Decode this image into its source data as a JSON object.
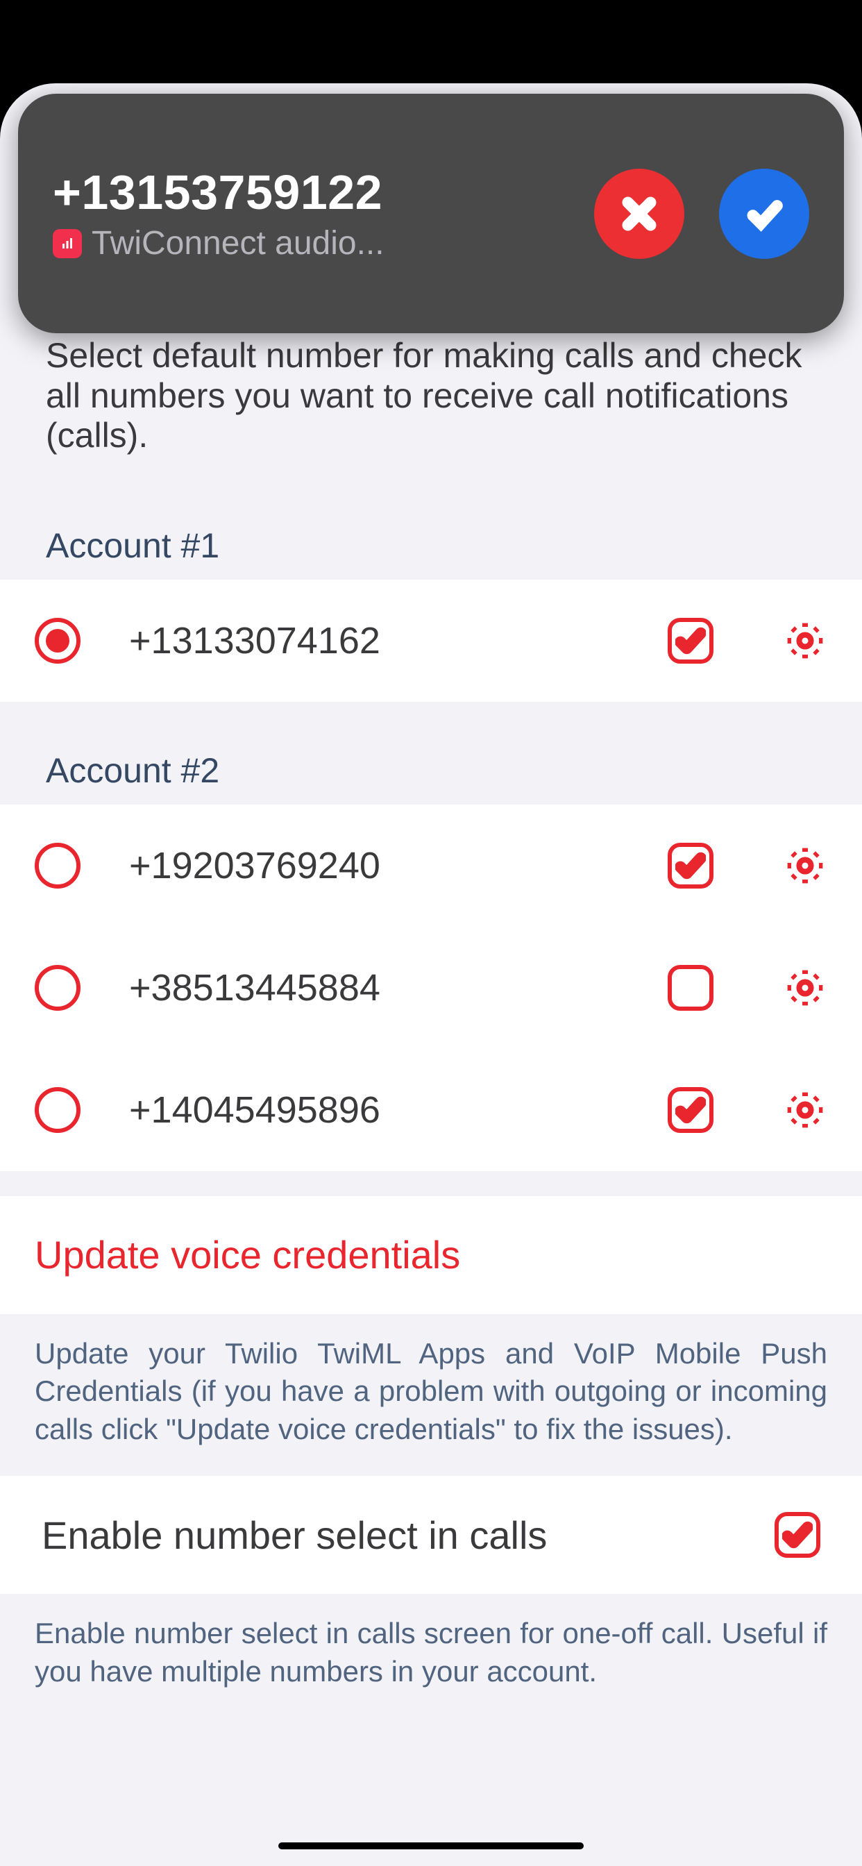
{
  "call_banner": {
    "number": "+13153759122",
    "subtitle": "TwiConnect audio..."
  },
  "intro_text": "Select default number for making calls and check all numbers you want to receive call notifications (calls).",
  "accounts": [
    {
      "header": "Account #1",
      "numbers": [
        {
          "phone": "+13133074162",
          "selected": true,
          "checked": true
        }
      ]
    },
    {
      "header": "Account #2",
      "numbers": [
        {
          "phone": "+19203769240",
          "selected": false,
          "checked": true
        },
        {
          "phone": "+38513445884",
          "selected": false,
          "checked": false
        },
        {
          "phone": "+14045495896",
          "selected": false,
          "checked": true
        }
      ]
    }
  ],
  "update_link": "Update voice credentials",
  "update_desc": "Update your Twilio TwiML Apps and VoIP Mobile Push Credentials (if you have a problem with outgoing or incoming calls click \"Update voice credentials\" to fix the issues).",
  "enable_select": {
    "label": "Enable number select in calls",
    "checked": true,
    "desc": "Enable number select in calls screen for one-off call. Useful if you have multiple numbers in your account."
  },
  "colors": {
    "accent": "#e9252e"
  }
}
